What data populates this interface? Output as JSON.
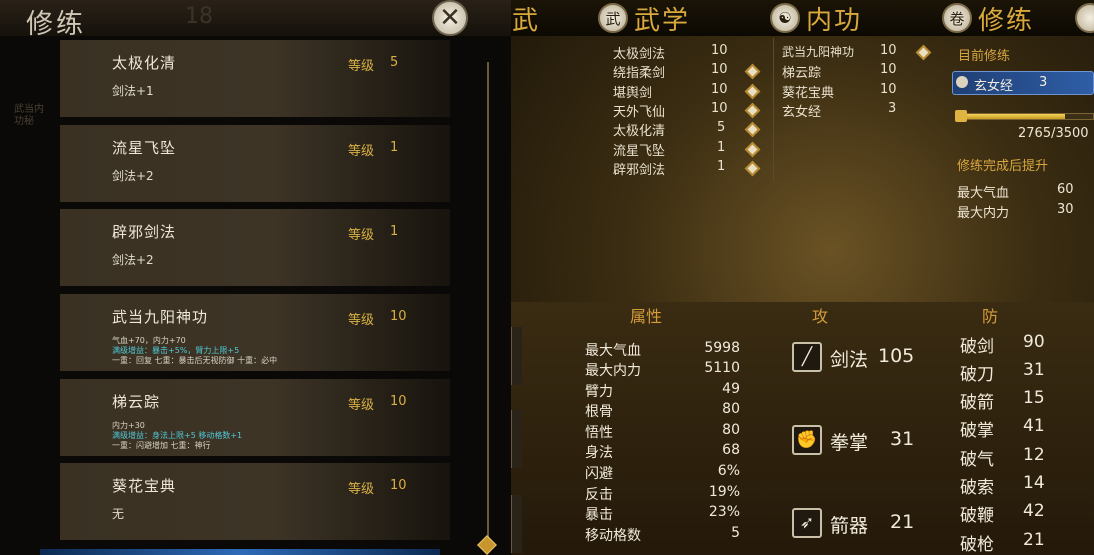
{
  "left_panel": {
    "title": "修练",
    "ghost_number": "18",
    "side_text": "武当内功秘",
    "level_label": "等级",
    "cards": [
      {
        "name": "太极化清",
        "level": "5",
        "desc": "剑法+1",
        "extra": []
      },
      {
        "name": "流星飞坠",
        "level": "1",
        "desc": "剑法+2",
        "extra": []
      },
      {
        "name": "辟邪剑法",
        "level": "1",
        "desc": "剑法+2",
        "extra": []
      },
      {
        "name": "武当九阳神功",
        "level": "10",
        "desc": "",
        "extra": [
          {
            "text": "气血+70，内力+70",
            "cyan": false
          },
          {
            "text": "满级增益：暴击+5%，臂力上限+5",
            "cyan": true
          },
          {
            "text": "一重：回复 七重：暴击后无视防御 十重：必中",
            "cyan": false
          }
        ]
      },
      {
        "name": "梯云踪",
        "level": "10",
        "desc": "",
        "extra": [
          {
            "text": "内力+30",
            "cyan": false
          },
          {
            "text": "满级增益：身法上限+5 移动格数+1",
            "cyan": true
          },
          {
            "text": "一重：闪避增加 七重：神行",
            "cyan": false
          }
        ]
      },
      {
        "name": "葵花宝典",
        "level": "10",
        "desc": "无",
        "extra": []
      }
    ]
  },
  "tabs": [
    {
      "label": "武",
      "icon": "",
      "icon_name": "cut-off-tab-icon"
    },
    {
      "label": "武学",
      "icon": "武",
      "icon_name": "martial-arts-icon"
    },
    {
      "label": "内功",
      "icon": "☯",
      "icon_name": "yin-yang-icon"
    },
    {
      "label": "修练",
      "icon": "卷",
      "icon_name": "scroll-icon"
    }
  ],
  "martial_arts": [
    {
      "name": "太极剑法",
      "level": "10",
      "upgrade": false
    },
    {
      "name": "绕指柔剑",
      "level": "10",
      "upgrade": true
    },
    {
      "name": "堪舆剑",
      "level": "10",
      "upgrade": true
    },
    {
      "name": "天外飞仙",
      "level": "10",
      "upgrade": true
    },
    {
      "name": "太极化清",
      "level": "5",
      "upgrade": true
    },
    {
      "name": "流星飞坠",
      "level": "1",
      "upgrade": true
    },
    {
      "name": "辟邪剑法",
      "level": "1",
      "upgrade": true
    }
  ],
  "inner_arts": [
    {
      "name": "武当九阳神功",
      "level": "10",
      "upgrade": true
    },
    {
      "name": "梯云踪",
      "level": "10",
      "upgrade": false
    },
    {
      "name": "葵花宝典",
      "level": "10",
      "upgrade": false
    },
    {
      "name": "玄女经",
      "level": "3",
      "upgrade": false
    }
  ],
  "current_training": {
    "heading": "目前修练",
    "name": "玄女经",
    "level": "3",
    "progress_text": "2765/3500",
    "progress": 0.79,
    "after_heading": "修练完成后提升",
    "boosts": [
      {
        "name": "最大气血",
        "value": "60"
      },
      {
        "name": "最大内力",
        "value": "30"
      }
    ]
  },
  "attributes": {
    "heading": "属性",
    "rows": [
      {
        "name": "最大气血",
        "value": "5998"
      },
      {
        "name": "最大内力",
        "value": "5110"
      },
      {
        "name": "臂力",
        "value": "49"
      },
      {
        "name": "根骨",
        "value": "80"
      },
      {
        "name": "悟性",
        "value": "80"
      },
      {
        "name": "身法",
        "value": "68"
      },
      {
        "name": "闪避",
        "value": "6%"
      },
      {
        "name": "反击",
        "value": "19%"
      },
      {
        "name": "暴击",
        "value": "23%"
      },
      {
        "name": "移动格数",
        "value": "5"
      }
    ]
  },
  "attack": {
    "heading": "攻",
    "rows": [
      {
        "name": "剑法",
        "value": "105",
        "icon": "sword-icon",
        "glyph": "╱"
      },
      {
        "name": "拳掌",
        "value": "31",
        "icon": "fist-icon",
        "glyph": "✊"
      },
      {
        "name": "箭器",
        "value": "21",
        "icon": "dart-icon",
        "glyph": "➶"
      }
    ]
  },
  "defense": {
    "heading": "防",
    "rows": [
      {
        "name": "破剑",
        "value": "90"
      },
      {
        "name": "破刀",
        "value": "31"
      },
      {
        "name": "破箭",
        "value": "15"
      },
      {
        "name": "破掌",
        "value": "41"
      },
      {
        "name": "破气",
        "value": "12"
      },
      {
        "name": "破索",
        "value": "14"
      },
      {
        "name": "破鞭",
        "value": "42"
      },
      {
        "name": "破枪",
        "value": "21"
      }
    ]
  }
}
